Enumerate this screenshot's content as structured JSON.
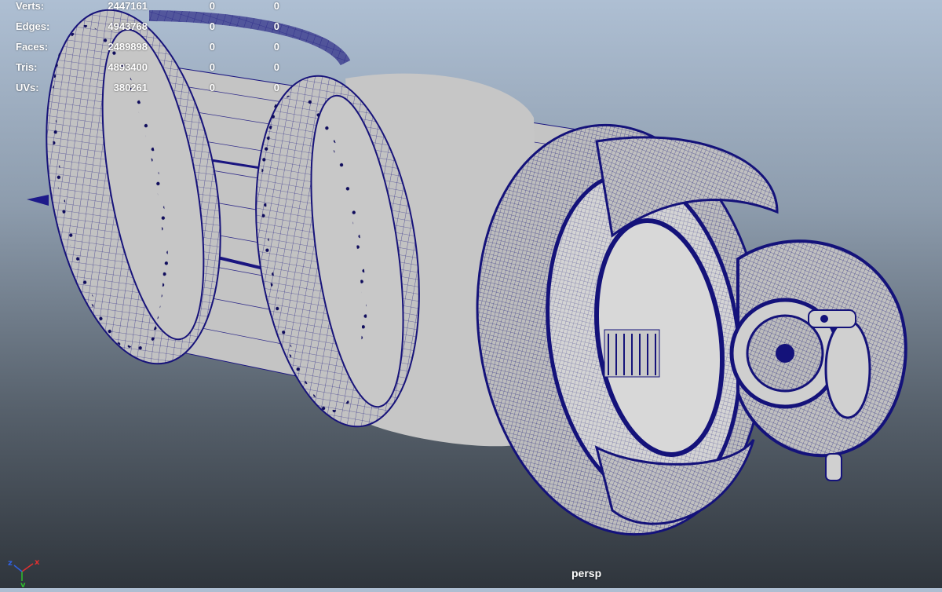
{
  "hud": {
    "rows": [
      {
        "label": "Verts:",
        "total": "2447161",
        "selected": "0",
        "component": "0"
      },
      {
        "label": "Edges:",
        "total": "4943768",
        "selected": "0",
        "component": "0"
      },
      {
        "label": "Faces:",
        "total": "2489898",
        "selected": "0",
        "component": "0"
      },
      {
        "label": "Tris:",
        "total": "4893400",
        "selected": "0",
        "component": "0"
      },
      {
        "label": "UVs:",
        "total": "380261",
        "selected": "0",
        "component": "0"
      }
    ]
  },
  "viewport": {
    "camera": "persp",
    "background_top": "#aebfd3",
    "background_bottom": "#2f353c",
    "wire_color": "#14127a",
    "surface_color": "#c4c4c4"
  },
  "axis": {
    "x": "x",
    "y": "y",
    "z": "z",
    "x_color": "#e03030",
    "y_color": "#2ec02e",
    "z_color": "#3060e0"
  }
}
